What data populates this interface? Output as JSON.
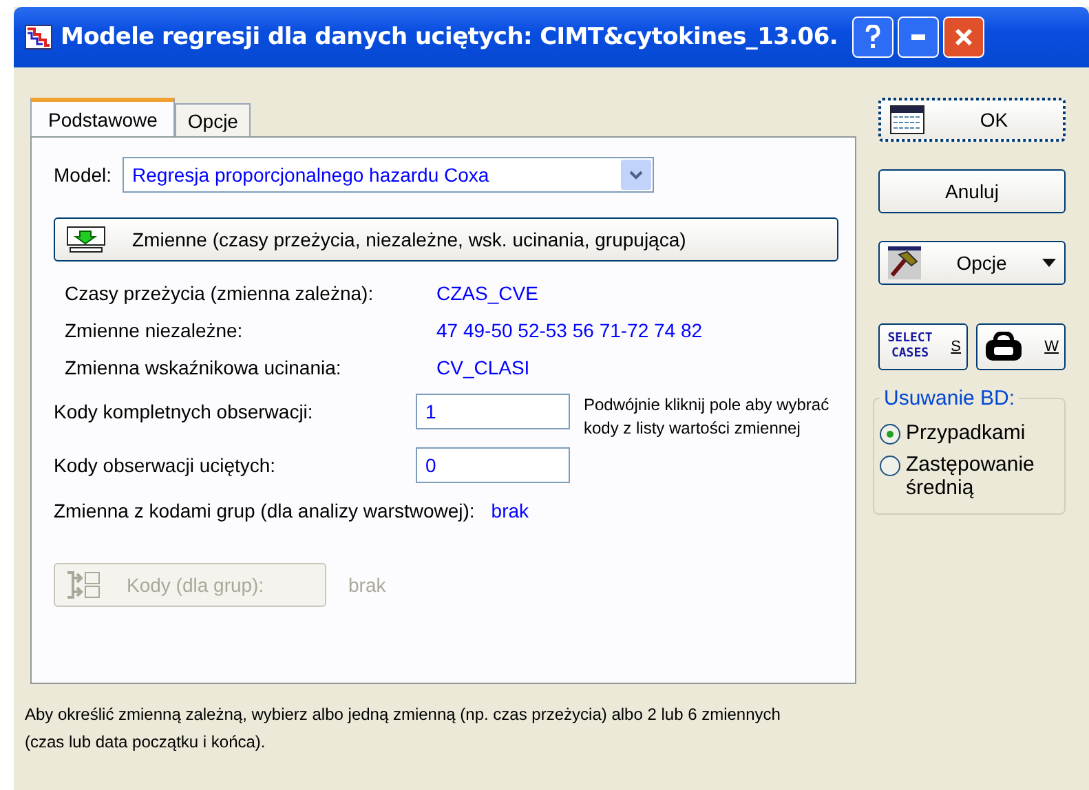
{
  "window": {
    "title": "Modele regresji dla danych uciętych: CIMT&cytokines_13.06."
  },
  "tabs": [
    {
      "label": "Podstawowe",
      "selected": true
    },
    {
      "label": "Opcje",
      "selected": false
    }
  ],
  "model": {
    "label": "Model:",
    "value": "Regresja proporcjonalnego hazardu Coxa"
  },
  "variables_button": "Zmienne (czasy przeżycia, niezależne, wsk. ucinania, grupująca)",
  "variables": [
    {
      "label": "Czasy przeżycia (zmienna zależna):",
      "value": "CZAS_CVE"
    },
    {
      "label": "Zmienne niezależne:",
      "value": "47 49-50 52-53 56 71-72 74 82"
    },
    {
      "label": "Zmienna wskaźnikowa ucinania:",
      "value": "CV_CLASI"
    }
  ],
  "code_fields": [
    {
      "label": "Kody kompletnych obserwacji:",
      "value": "1"
    },
    {
      "label": "Kody obserwacji uciętych:",
      "value": "0"
    }
  ],
  "hint": "Podwójnie kliknij pole aby wybrać kody z listy wartości zmiennej",
  "group_variable": {
    "label": "Zmienna z kodami grup (dla analizy warstwowej):",
    "value": "brak"
  },
  "group_codes": {
    "button": "Kody (dla grup):",
    "value": "brak",
    "disabled": true
  },
  "note": "Aby określić zmienną zależną, wybierz albo jedną zmienną (np. czas przeżycia) albo 2 lub 6 zmiennych (czas lub data początku i końca).",
  "buttons": [
    {
      "kind": "ok",
      "label": "OK"
    },
    {
      "kind": "cancel",
      "label": "Anuluj"
    },
    {
      "kind": "menu",
      "label": "Opcje"
    }
  ],
  "tool_buttons": [
    {
      "kind": "select-cases",
      "icon_text": "SELECT CASES",
      "label": "S"
    },
    {
      "kind": "weight",
      "label": "W"
    }
  ],
  "missing_data": {
    "title": "Usuwanie BD:",
    "options": [
      {
        "label": "Przypadkami",
        "selected": true
      },
      {
        "label": "Zastępowanie średnią",
        "selected": false
      }
    ]
  }
}
